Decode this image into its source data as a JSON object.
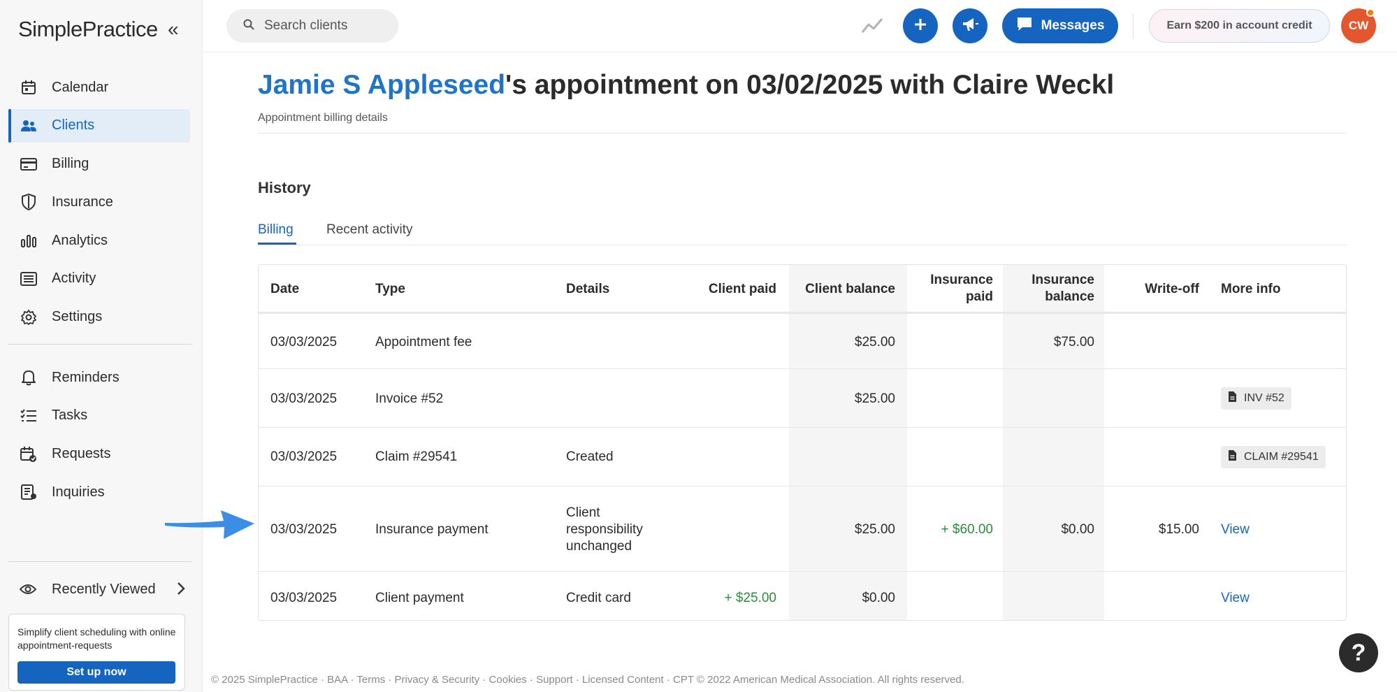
{
  "sidebar": {
    "logo": "SimplePractice",
    "collapse_glyph": "«",
    "items": [
      {
        "label": "Calendar",
        "icon": "calendar-icon"
      },
      {
        "label": "Clients",
        "icon": "clients-icon",
        "active": true
      },
      {
        "label": "Billing",
        "icon": "billing-card-icon"
      },
      {
        "label": "Insurance",
        "icon": "shield-icon"
      },
      {
        "label": "Analytics",
        "icon": "analytics-bars-icon"
      },
      {
        "label": "Activity",
        "icon": "activity-list-icon"
      },
      {
        "label": "Settings",
        "icon": "gear-icon"
      }
    ],
    "items2": [
      {
        "label": "Reminders",
        "icon": "bell-icon"
      },
      {
        "label": "Tasks",
        "icon": "tasks-icon"
      },
      {
        "label": "Requests",
        "icon": "calendar-request-icon"
      },
      {
        "label": "Inquiries",
        "icon": "inquiries-icon"
      }
    ],
    "recently_viewed": "Recently Viewed",
    "promo": {
      "text": "Simplify client scheduling with online appointment-requests",
      "button": "Set up now"
    }
  },
  "topbar": {
    "search_placeholder": "Search clients",
    "messages_label": "Messages",
    "earn_label": "Earn $200 in account credit",
    "avatar_initials": "CW"
  },
  "page": {
    "client_name": "Jamie S Appleseed",
    "title_rest": "'s appointment on 03/02/2025 with Claire Weckl",
    "subtitle": "Appointment billing details",
    "history_heading": "History",
    "tabs": [
      "Billing",
      "Recent activity"
    ]
  },
  "table": {
    "headers": {
      "date": "Date",
      "type": "Type",
      "details": "Details",
      "client_paid": "Client paid",
      "client_balance": "Client balance",
      "insurance_paid_1": "Insurance",
      "insurance_paid_2": "paid",
      "insurance_balance_1": "Insurance",
      "insurance_balance_2": "balance",
      "write_off": "Write-off",
      "more_info": "More info"
    },
    "rows": [
      {
        "date": "03/03/2025",
        "type": "Appointment fee",
        "details": "",
        "client_paid": "",
        "client_balance": "$25.00",
        "insurance_paid": "",
        "insurance_balance": "$75.00",
        "write_off": "",
        "more_info": ""
      },
      {
        "date": "03/03/2025",
        "type": "Invoice #52",
        "details": "",
        "client_paid": "",
        "client_balance": "$25.00",
        "insurance_paid": "",
        "insurance_balance": "",
        "write_off": "",
        "more_info": "INV #52"
      },
      {
        "date": "03/03/2025",
        "type": "Claim #29541",
        "details": "Created",
        "client_paid": "",
        "client_balance": "",
        "insurance_paid": "",
        "insurance_balance": "",
        "write_off": "",
        "more_info": "CLAIM #29541"
      },
      {
        "date": "03/03/2025",
        "type": "Insurance payment",
        "details_lines": [
          "Client",
          "responsibility",
          "unchanged"
        ],
        "client_paid": "",
        "client_balance": "$25.00",
        "insurance_paid": "+ $60.00",
        "insurance_balance": "$0.00",
        "write_off": "$15.00",
        "more_info": "View"
      },
      {
        "date": "03/03/2025",
        "type": "Client payment",
        "details": "Credit card",
        "client_paid": "+ $25.00",
        "client_balance": "$0.00",
        "insurance_paid": "",
        "insurance_balance": "",
        "write_off": "",
        "more_info": "View"
      }
    ]
  },
  "footer": "© 2025 SimplePractice · BAA · Terms · Privacy & Security · Cookies · Support · Licensed Content · CPT © 2022 American Medical Association. All rights reserved.",
  "help_glyph": "?",
  "colors": {
    "accent": "#1565c0",
    "link": "#1e74c9",
    "positive": "#2e8b3e",
    "avatar": "#e4572e"
  }
}
